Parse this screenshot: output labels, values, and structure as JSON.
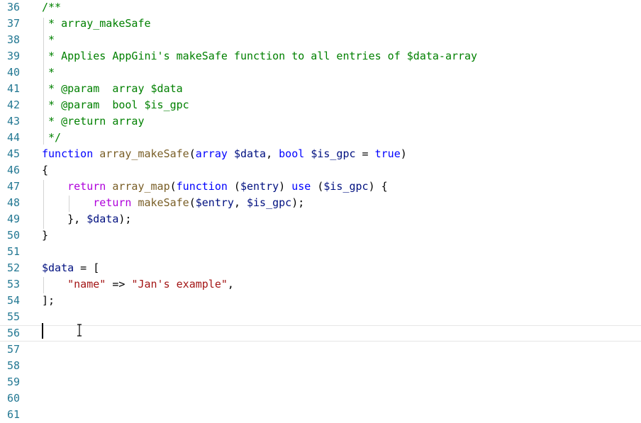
{
  "editor": {
    "colors": {
      "line_number": "#237893",
      "default": "#000000",
      "comment": "#008000",
      "keyword": "#0000ff",
      "control": "#af00db",
      "function": "#795e26",
      "variable": "#001080",
      "string": "#a31515",
      "type": "#267f99"
    },
    "cursor_icon": "text-cursor-ibeam-icon",
    "current_line": "56",
    "lines": [
      {
        "num": "36",
        "tokens": [
          {
            "t": "/**",
            "c": "comment"
          }
        ]
      },
      {
        "num": "37",
        "tokens": [
          {
            "t": " * array_makeSafe",
            "c": "comment"
          }
        ]
      },
      {
        "num": "38",
        "tokens": [
          {
            "t": " *",
            "c": "comment"
          }
        ]
      },
      {
        "num": "39",
        "tokens": [
          {
            "t": " * Applies AppGini's makeSafe function to all entries of $data-array",
            "c": "comment"
          }
        ]
      },
      {
        "num": "40",
        "tokens": [
          {
            "t": " *",
            "c": "comment"
          }
        ]
      },
      {
        "num": "41",
        "tokens": [
          {
            "t": " * @param  array $data",
            "c": "comment"
          }
        ]
      },
      {
        "num": "42",
        "tokens": [
          {
            "t": " * @param  bool $is_gpc",
            "c": "comment"
          }
        ]
      },
      {
        "num": "43",
        "tokens": [
          {
            "t": " * @return array",
            "c": "comment"
          }
        ]
      },
      {
        "num": "44",
        "tokens": [
          {
            "t": " */",
            "c": "comment"
          }
        ]
      },
      {
        "num": "45",
        "tokens": [
          {
            "t": "function",
            "c": "keyword"
          },
          {
            "t": " ",
            "c": "default"
          },
          {
            "t": "array_makeSafe",
            "c": "function"
          },
          {
            "t": "(",
            "c": "default"
          },
          {
            "t": "array",
            "c": "keyword"
          },
          {
            "t": " ",
            "c": "default"
          },
          {
            "t": "$data",
            "c": "variable"
          },
          {
            "t": ", ",
            "c": "default"
          },
          {
            "t": "bool",
            "c": "keyword"
          },
          {
            "t": " ",
            "c": "default"
          },
          {
            "t": "$is_gpc",
            "c": "variable"
          },
          {
            "t": " = ",
            "c": "default"
          },
          {
            "t": "true",
            "c": "keyword"
          },
          {
            "t": ")",
            "c": "default"
          }
        ]
      },
      {
        "num": "46",
        "tokens": [
          {
            "t": "{",
            "c": "default"
          }
        ]
      },
      {
        "num": "47",
        "tokens": [
          {
            "t": "    ",
            "c": "default"
          },
          {
            "t": "return",
            "c": "control"
          },
          {
            "t": " ",
            "c": "default"
          },
          {
            "t": "array_map",
            "c": "function"
          },
          {
            "t": "(",
            "c": "default"
          },
          {
            "t": "function",
            "c": "keyword"
          },
          {
            "t": " (",
            "c": "default"
          },
          {
            "t": "$entry",
            "c": "variable"
          },
          {
            "t": ") ",
            "c": "default"
          },
          {
            "t": "use",
            "c": "keyword"
          },
          {
            "t": " (",
            "c": "default"
          },
          {
            "t": "$is_gpc",
            "c": "variable"
          },
          {
            "t": ") {",
            "c": "default"
          }
        ]
      },
      {
        "num": "48",
        "tokens": [
          {
            "t": "        ",
            "c": "default"
          },
          {
            "t": "return",
            "c": "control"
          },
          {
            "t": " ",
            "c": "default"
          },
          {
            "t": "makeSafe",
            "c": "function"
          },
          {
            "t": "(",
            "c": "default"
          },
          {
            "t": "$entry",
            "c": "variable"
          },
          {
            "t": ", ",
            "c": "default"
          },
          {
            "t": "$is_gpc",
            "c": "variable"
          },
          {
            "t": ");",
            "c": "default"
          }
        ]
      },
      {
        "num": "49",
        "tokens": [
          {
            "t": "    }, ",
            "c": "default"
          },
          {
            "t": "$data",
            "c": "variable"
          },
          {
            "t": ");",
            "c": "default"
          }
        ]
      },
      {
        "num": "50",
        "tokens": [
          {
            "t": "}",
            "c": "default"
          }
        ]
      },
      {
        "num": "51",
        "tokens": []
      },
      {
        "num": "52",
        "tokens": [
          {
            "t": "$data",
            "c": "variable"
          },
          {
            "t": " = [",
            "c": "default"
          }
        ]
      },
      {
        "num": "53",
        "tokens": [
          {
            "t": "    ",
            "c": "default"
          },
          {
            "t": "\"name\"",
            "c": "string"
          },
          {
            "t": " => ",
            "c": "default"
          },
          {
            "t": "\"Jan's example\"",
            "c": "string"
          },
          {
            "t": ",",
            "c": "default"
          }
        ]
      },
      {
        "num": "54",
        "tokens": [
          {
            "t": "];",
            "c": "default"
          }
        ]
      },
      {
        "num": "55",
        "tokens": []
      },
      {
        "num": "56",
        "tokens": []
      },
      {
        "num": "57",
        "tokens": []
      },
      {
        "num": "58",
        "tokens": []
      },
      {
        "num": "59",
        "tokens": []
      },
      {
        "num": "60",
        "tokens": []
      },
      {
        "num": "61",
        "tokens": []
      }
    ]
  }
}
